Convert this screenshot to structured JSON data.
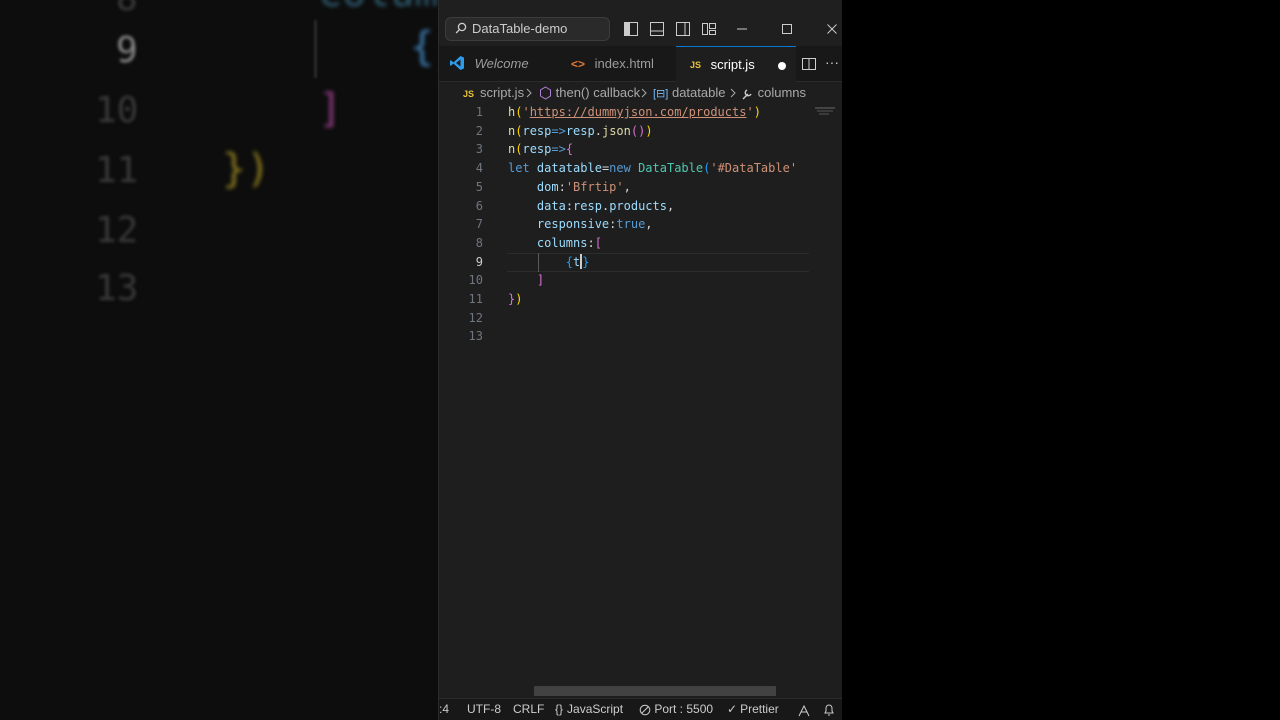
{
  "background": {
    "line_numbers": [
      "8",
      "9",
      "10",
      "11",
      "12",
      "13"
    ],
    "code_fragments": [
      "colum",
      "{",
      "]",
      "})"
    ]
  },
  "titlebar": {
    "search_text": "DataTable-demo",
    "window_controls": [
      "minimize",
      "maximize",
      "close"
    ]
  },
  "tabs": [
    {
      "label": "Welcome",
      "icon": "vscode-logo-icon"
    },
    {
      "label": "index.html",
      "icon": "html-icon"
    },
    {
      "label": "script.js",
      "icon": "js-icon",
      "active": true,
      "modified": true
    }
  ],
  "tab_icons": {
    "js": "JS",
    "html": "<>"
  },
  "breadcrumb": {
    "items": [
      "script.js",
      "then() callback",
      "datatable",
      "columns"
    ]
  },
  "editor": {
    "current_line": 9,
    "line_numbers": [
      "1",
      "2",
      "3",
      "4",
      "5",
      "6",
      "7",
      "8",
      "9",
      "10",
      "11",
      "12",
      "13"
    ]
  },
  "statusbar": {
    "position": ":4",
    "encoding": "UTF-8",
    "eol": "CRLF",
    "language": "JavaScript",
    "port": "Port : 5500",
    "formatter": "Prettier"
  },
  "colors": {
    "editor_bg": "#1e1e1e",
    "accent": "#0078d4",
    "string": "#ce9178",
    "keyword": "#569cd6",
    "variable": "#9cdcfe",
    "function": "#dcdcaa"
  }
}
